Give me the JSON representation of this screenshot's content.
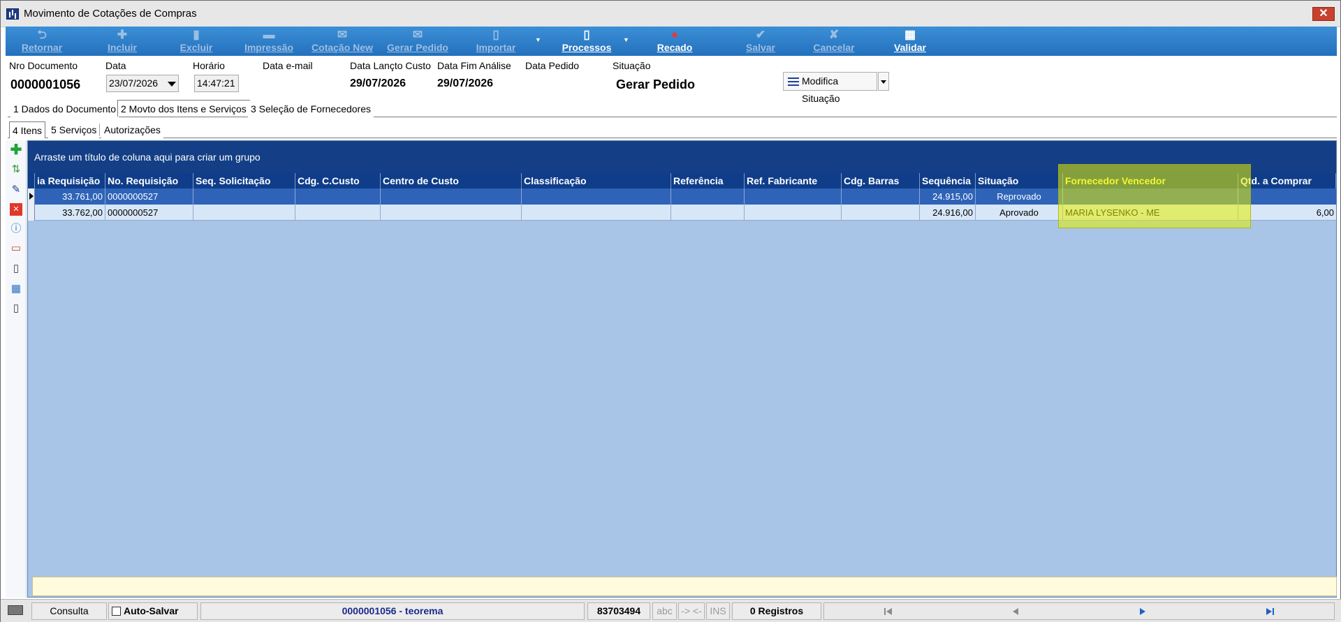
{
  "window": {
    "title": "Movimento de Cotações de Compras",
    "close_glyph": "✕"
  },
  "toolbar": {
    "buttons": [
      {
        "label": "Retornar",
        "icon": "undo-arrow-icon",
        "glyph": "⮌",
        "enabled": false
      },
      {
        "label": "Incluir",
        "icon": "plus-icon",
        "glyph": "✚",
        "enabled": false
      },
      {
        "label": "Excluir",
        "icon": "trash-icon",
        "glyph": "▮",
        "enabled": false
      },
      {
        "label": "Impressão",
        "icon": "printer-icon",
        "glyph": "▬",
        "enabled": false
      },
      {
        "label": "Cotação New",
        "icon": "quotation-icon",
        "glyph": "✉",
        "enabled": false
      },
      {
        "label": "Gerar Pedido",
        "icon": "order-icon",
        "glyph": "✉",
        "enabled": false
      },
      {
        "label": "Importar",
        "icon": "import-icon",
        "glyph": "▯",
        "enabled": false
      },
      {
        "label": "Processos",
        "icon": "process-icon",
        "glyph": "▯",
        "enabled": true
      },
      {
        "label": "Recado",
        "icon": "message-icon",
        "glyph": "●",
        "enabled": true
      },
      {
        "label": "Salvar",
        "icon": "save-check-icon",
        "glyph": "✔",
        "enabled": false
      },
      {
        "label": "Cancelar",
        "icon": "cancel-icon",
        "glyph": "✘",
        "enabled": false
      },
      {
        "label": "Validar",
        "icon": "validate-icon",
        "glyph": "▦",
        "enabled": true
      }
    ],
    "dropdown_glyph": "▼"
  },
  "header": {
    "nro_documento": {
      "label": "Nro Documento",
      "value": "0000001056"
    },
    "data": {
      "label": "Data",
      "value": "23/07/2026"
    },
    "horario": {
      "label": "Horário",
      "value": "14:47:21"
    },
    "data_email": {
      "label": "Data e-mail",
      "value": ""
    },
    "data_lancto_custo": {
      "label": "Data Lançto Custo",
      "value": "29/07/2026"
    },
    "data_fim_analise": {
      "label": "Data Fim Análise",
      "value": "29/07/2026"
    },
    "data_pedido": {
      "label": "Data Pedido",
      "value": ""
    },
    "situacao": {
      "label": "Situação",
      "value": "Gerar Pedido"
    },
    "modifica_situacao": "Modifica Situação"
  },
  "tabs": [
    "1 Dados do Documento",
    "2 Movto dos Itens e Serviços",
    "3 Seleção de Fornecedores"
  ],
  "subtabs": [
    "4 Itens",
    "5 Serviços",
    "Autorizações"
  ],
  "grid": {
    "group_panel_text": "Arraste um título de coluna aqui para criar um grupo",
    "columns": [
      "ia Requisição",
      "No. Requisição",
      "Seq. Solicitação",
      "Cdg. C.Custo",
      "Centro de Custo",
      "Classificação",
      "Referência",
      "Ref. Fabricante",
      "Cdg. Barras",
      "Sequência",
      "Situação",
      "Fornecedor Vencedor",
      "Qtd. a Comprar"
    ],
    "rows": [
      [
        "33.761,00",
        "0000000527",
        "",
        "",
        "",
        "",
        "",
        "",
        "",
        "24.915,00",
        "Reprovado",
        "",
        ""
      ],
      [
        "33.762,00",
        "0000000527",
        "",
        "",
        "",
        "",
        "",
        "",
        "",
        "24.916,00",
        "Aprovado",
        "MARIA LYSENKO - ME",
        "6,00"
      ]
    ]
  },
  "statusbar": {
    "mode": "Consulta",
    "auto_salvar": "Auto-Salvar",
    "doc_user": "0000001056 - teorema",
    "code": "83703494",
    "abc": "abc",
    "arrows": "-> <-",
    "ins": "INS",
    "registros": "0 Registros"
  }
}
